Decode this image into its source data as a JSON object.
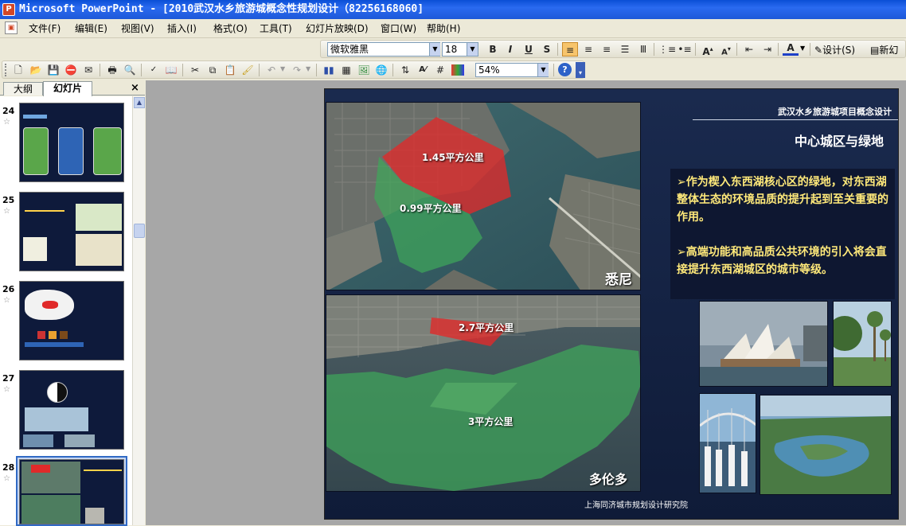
{
  "window": {
    "title": "Microsoft PowerPoint - [2010武汉水乡旅游城概念性规划设计（82256168060]",
    "app_icon": "powerpoint-icon"
  },
  "menu": [
    "文件(F)",
    "编辑(E)",
    "视图(V)",
    "插入(I)",
    "格式(O)",
    "工具(T)",
    "幻灯片放映(D)",
    "窗口(W)",
    "帮助(H)"
  ],
  "format_toolbar": {
    "font": "微软雅黑",
    "size": "18",
    "bold": "B",
    "italic": "I",
    "underline": "U",
    "shadow": "S",
    "design_label": "设计(S)",
    "new_slide_label": "新幻"
  },
  "standard_toolbar": {
    "zoom": "54%"
  },
  "pane": {
    "tabs": [
      "大纲",
      "幻灯片"
    ],
    "active_tab": "幻灯片",
    "close": "×",
    "slides": [
      {
        "num": "24",
        "selected": false
      },
      {
        "num": "25",
        "selected": false
      },
      {
        "num": "26",
        "selected": false
      },
      {
        "num": "27",
        "selected": false
      },
      {
        "num": "28",
        "selected": true
      }
    ]
  },
  "slide": {
    "header": "武汉水乡旅游城项目概念设计",
    "subtitle": "中心城区与绿地",
    "bullets": [
      "➢作为楔入东西湖核心区的绿地，对东西湖整体生态的环境品质的提升起到至关重要的作用。",
      "➢高端功能和高品质公共环境的引入将会直接提升东西湖城区的城市等级。"
    ],
    "map_sydney": {
      "city": "悉尼",
      "area_red": "1.45平方公里",
      "area_green": "0.99平方公里"
    },
    "map_toronto": {
      "city": "多伦多",
      "area_red": "2.7平方公里",
      "area_green": "3平方公里"
    },
    "footer": "上海同济城市规划设计研究院"
  },
  "colors": {
    "titlebar": "#0a4fd6",
    "slide_bg": "#14223f",
    "accent_yellow": "#ffe97a",
    "zone_red": "#e02a2a",
    "zone_green": "#3ea65a"
  }
}
